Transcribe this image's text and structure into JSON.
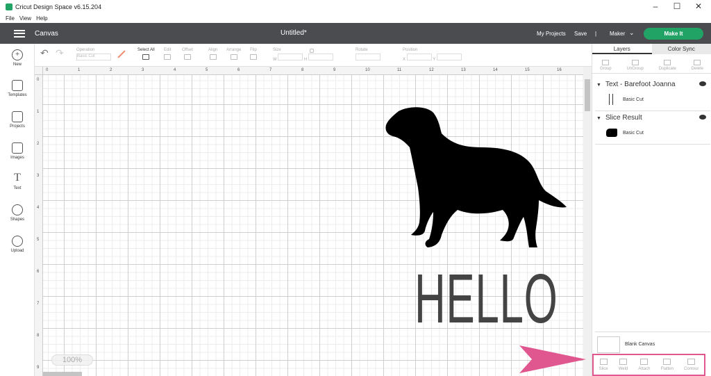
{
  "window": {
    "title": "Cricut Design Space  v6.15.204",
    "controls": [
      "–",
      "☐",
      "✕"
    ]
  },
  "menu": [
    "File",
    "View",
    "Help"
  ],
  "header": {
    "section": "Canvas",
    "doc_title": "Untitled*",
    "my_projects": "My Projects",
    "save": "Save",
    "separator": "|",
    "machine": "Maker",
    "make_it": "Make It"
  },
  "toolbar": {
    "operation_label": "Operation",
    "operation_value": "Basic Cut",
    "select_all": "Select All",
    "edit": "Edit",
    "offset": "Offset",
    "align": "Align",
    "arrange": "Arrange",
    "flip": "Flip",
    "size": "Size",
    "size_w": "W",
    "size_h": "H",
    "rotate": "Rotate",
    "position": "Position",
    "pos_x": "X",
    "pos_y": "Y"
  },
  "sidebar": [
    {
      "label": "New",
      "icon": "plus-icon"
    },
    {
      "label": "Templates",
      "icon": "shirt-icon"
    },
    {
      "label": "Projects",
      "icon": "notebook-icon"
    },
    {
      "label": "Images",
      "icon": "image-icon"
    },
    {
      "label": "Text",
      "icon": "text-icon"
    },
    {
      "label": "Shapes",
      "icon": "shapes-icon"
    },
    {
      "label": "Upload",
      "icon": "cloud-upload-icon"
    }
  ],
  "ruler": {
    "top": [
      "0",
      "1",
      "2",
      "3",
      "4",
      "5",
      "6",
      "7",
      "8",
      "9",
      "10",
      "11",
      "12",
      "13",
      "14",
      "15",
      "16"
    ],
    "left": [
      "0",
      "1",
      "2",
      "3",
      "4",
      "5",
      "6",
      "7",
      "8",
      "9"
    ]
  },
  "canvas": {
    "text": "HELLO",
    "zoom": "100%"
  },
  "panel": {
    "tabs": [
      "Layers",
      "Color Sync"
    ],
    "tools": [
      "Group",
      "UnGroup",
      "Duplicate",
      "Delete"
    ],
    "layers": [
      {
        "name": "Text - Barefoot Joanna",
        "sub": "Basic Cut"
      },
      {
        "name": "Slice Result",
        "sub": "Basic Cut"
      }
    ],
    "blank_canvas": "Blank Canvas",
    "bottom_tools": [
      "Slice",
      "Weld",
      "Attach",
      "Flatten",
      "Contour"
    ]
  },
  "colors": {
    "header": "#4a4c50",
    "make_it": "#21a366",
    "highlight": "#e0578f"
  }
}
